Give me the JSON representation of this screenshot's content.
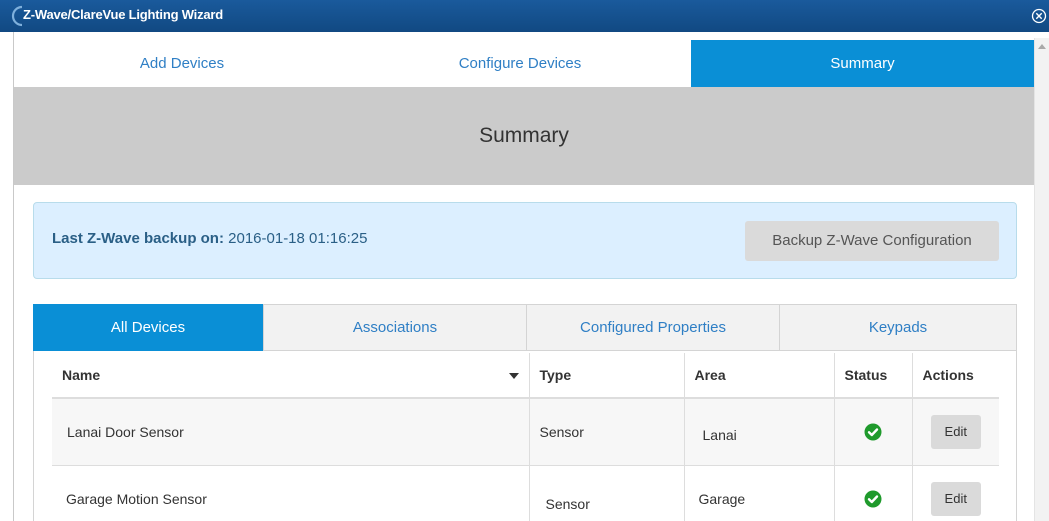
{
  "window": {
    "title": "Z-Wave/ClareVue Lighting Wizard"
  },
  "wizard_tabs": [
    {
      "label": "Add Devices",
      "active": false
    },
    {
      "label": "Configure Devices",
      "active": false
    },
    {
      "label": "Summary",
      "active": true
    }
  ],
  "summary": {
    "heading": "Summary"
  },
  "backup": {
    "label": "Last Z-Wave backup on:",
    "timestamp": "2016-01-18 01:16:25",
    "button_label": "Backup Z-Wave Configuration"
  },
  "device_tabs": [
    {
      "label": "All Devices",
      "active": true
    },
    {
      "label": "Associations",
      "active": false
    },
    {
      "label": "Configured Properties",
      "active": false
    },
    {
      "label": "Keypads",
      "active": false
    }
  ],
  "table": {
    "columns": [
      "Name",
      "Type",
      "Area",
      "Status",
      "Actions"
    ],
    "rows": [
      {
        "name": "Lanai Door Sensor",
        "type": "Sensor",
        "area": "Lanai",
        "status": "ok",
        "action": "Edit"
      },
      {
        "name": "Garage Motion Sensor",
        "type": "Sensor",
        "area": "Garage",
        "status": "ok",
        "action": "Edit"
      }
    ]
  },
  "colors": {
    "title_bar": "#114982",
    "accent": "#0a8fd6",
    "link": "#2f7fc5",
    "status_ok": "#1f9a2c",
    "banner": "#cbcbcb",
    "info_box": "#dcefff"
  }
}
